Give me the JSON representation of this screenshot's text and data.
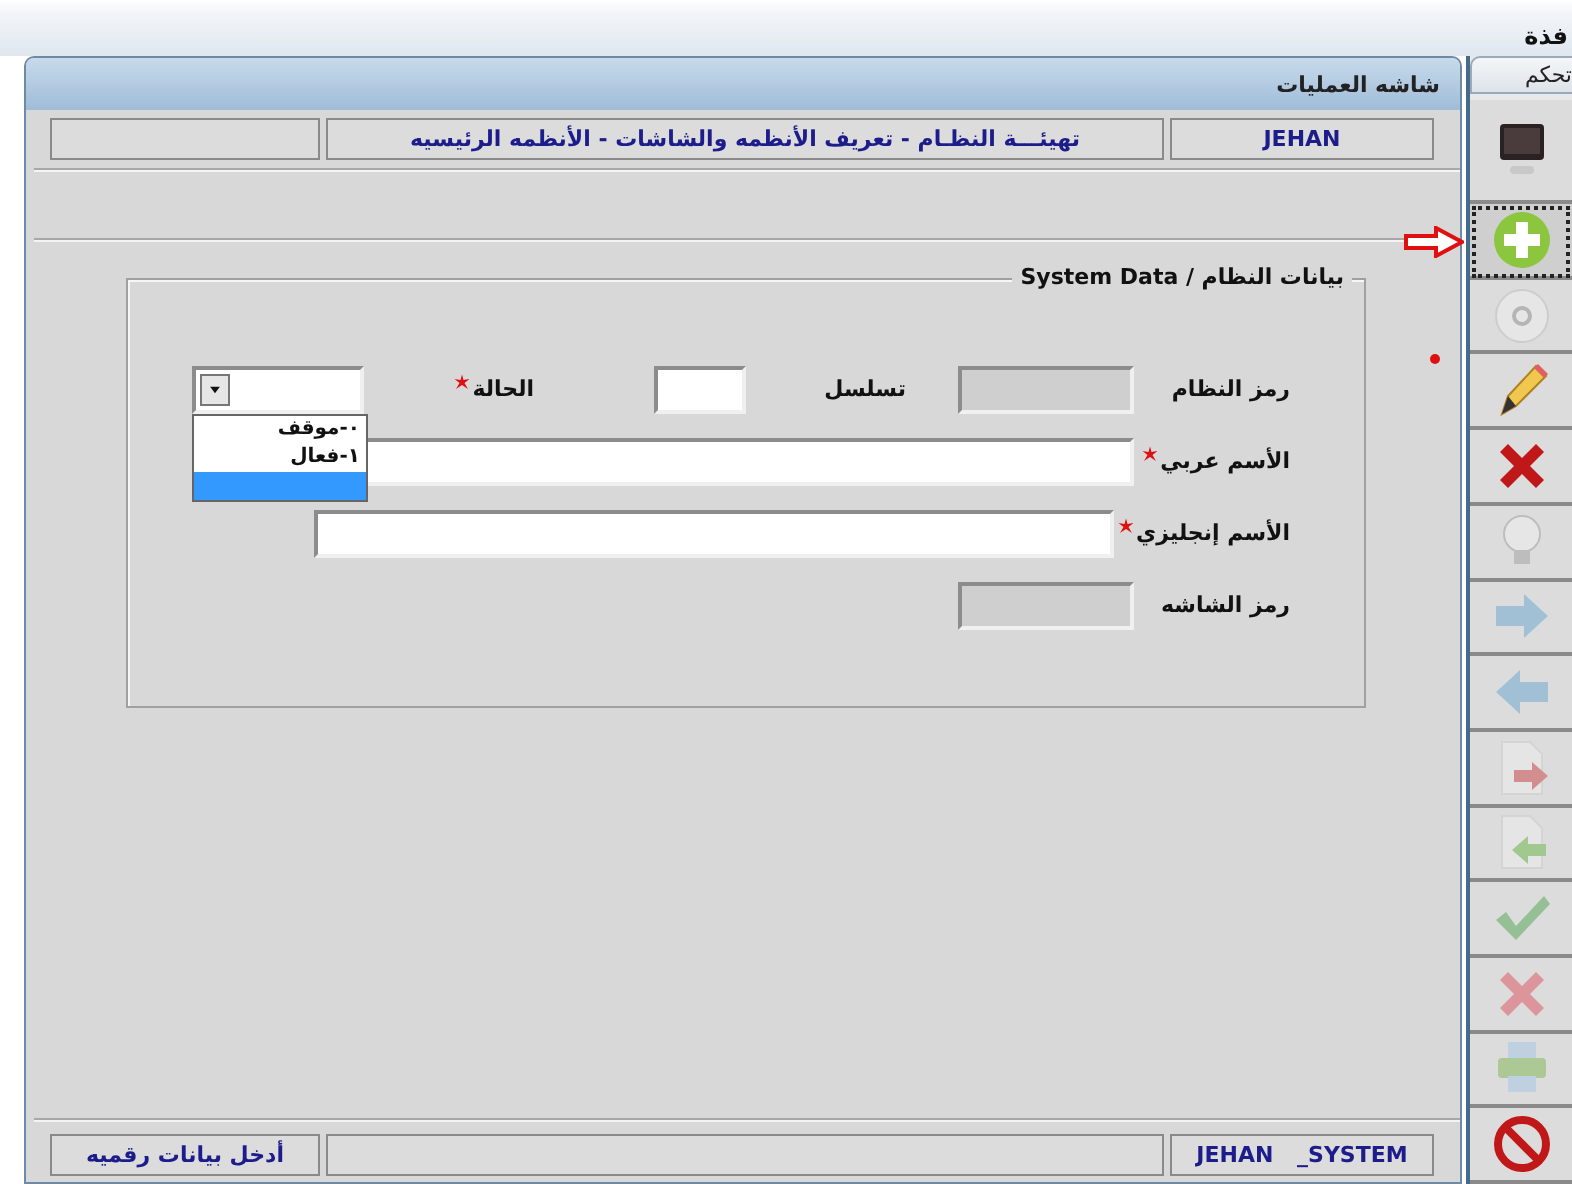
{
  "window": {
    "title": "فذة"
  },
  "panel": {
    "title": "شاشه العمليات",
    "path": "تهيئـــة النظـام - تعريف الأنظمه والشاشات - الأنظمه الرئيسيه",
    "user": "JEHAN"
  },
  "group": {
    "legend": "بيانات النظام / System Data",
    "rows": [
      [
        {
          "label": "رمز النظام",
          "kind": "code",
          "required": false,
          "readonly": true
        },
        {
          "label": "تسلسل",
          "kind": "short",
          "required": false,
          "readonly": false
        },
        {
          "label": "الحالة",
          "kind": "combo",
          "required": true,
          "readonly": false,
          "open": true,
          "blank_selected": true,
          "options": [
            {
              "label": "٠-موقف",
              "selected": false
            },
            {
              "label": "١-فعال",
              "selected": false
            }
          ]
        }
      ],
      [
        {
          "label": "الأسم عربي",
          "kind": "wide",
          "required": true,
          "readonly": false
        }
      ],
      [
        {
          "label": "الأسم إنجليزي",
          "kind": "wide",
          "required": true,
          "readonly": false
        }
      ],
      [
        {
          "label": "رمز الشاشه",
          "kind": "code",
          "required": false,
          "readonly": true
        }
      ]
    ]
  },
  "status_bar": {
    "message": "أدخل بيانات رقميه",
    "user": "JEHAN _SYSTEM"
  },
  "sidebar": {
    "tab": "تحكم",
    "tools": [
      {
        "kind": "monitor",
        "disabled": false,
        "selected": false
      },
      {
        "kind": "add",
        "disabled": false,
        "selected": true
      },
      {
        "kind": "disc",
        "disabled": true,
        "selected": false
      },
      {
        "kind": "pencil",
        "disabled": false,
        "selected": false
      },
      {
        "kind": "delete",
        "disabled": false,
        "selected": false
      },
      {
        "kind": "bulb",
        "disabled": true,
        "selected": false
      },
      {
        "kind": "next",
        "disabled": true,
        "selected": false
      },
      {
        "kind": "prev",
        "disabled": true,
        "selected": false
      },
      {
        "kind": "export",
        "disabled": true,
        "selected": false
      },
      {
        "kind": "import",
        "disabled": true,
        "selected": false
      },
      {
        "kind": "confirm",
        "disabled": true,
        "selected": false
      },
      {
        "kind": "cancel",
        "disabled": true,
        "selected": false
      },
      {
        "kind": "print",
        "disabled": true,
        "selected": false
      },
      {
        "kind": "stop",
        "disabled": false,
        "selected": false
      }
    ]
  }
}
